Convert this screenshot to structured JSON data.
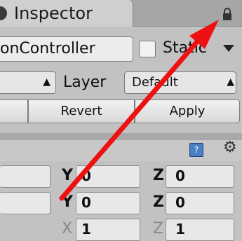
{
  "title_bar": {
    "tab_label": "Inspector",
    "tab_icon": "tab-icon",
    "lock_icon": "lock-icon"
  },
  "object": {
    "name": "onController",
    "static_label": "Static",
    "static_checked": false
  },
  "tag_layer": {
    "layer_label": "Layer",
    "layer_value": "Default"
  },
  "prefab": {
    "revert_label": "Revert",
    "apply_label": "Apply"
  },
  "component_header": {
    "help_icon": "help-icon",
    "gear_icon": "gear-icon"
  },
  "transform": {
    "rows": [
      {
        "y_label": "Y",
        "y_value": "0",
        "z_label": "Z",
        "z_value": "0"
      },
      {
        "y_label": "Y",
        "y_value": "0",
        "z_label": "Z",
        "z_value": "0"
      },
      {
        "x_label": "X",
        "x_value": "1",
        "z_label": "Z",
        "z_value": "1"
      }
    ]
  },
  "annotation": {
    "type": "arrow",
    "color": "#ee1111",
    "target": "lock-icon"
  },
  "colors": {
    "annotation_red": "#ee1111",
    "panel_bg": "#c2c2c2",
    "title_bar_bg": "#a6a6a6"
  }
}
